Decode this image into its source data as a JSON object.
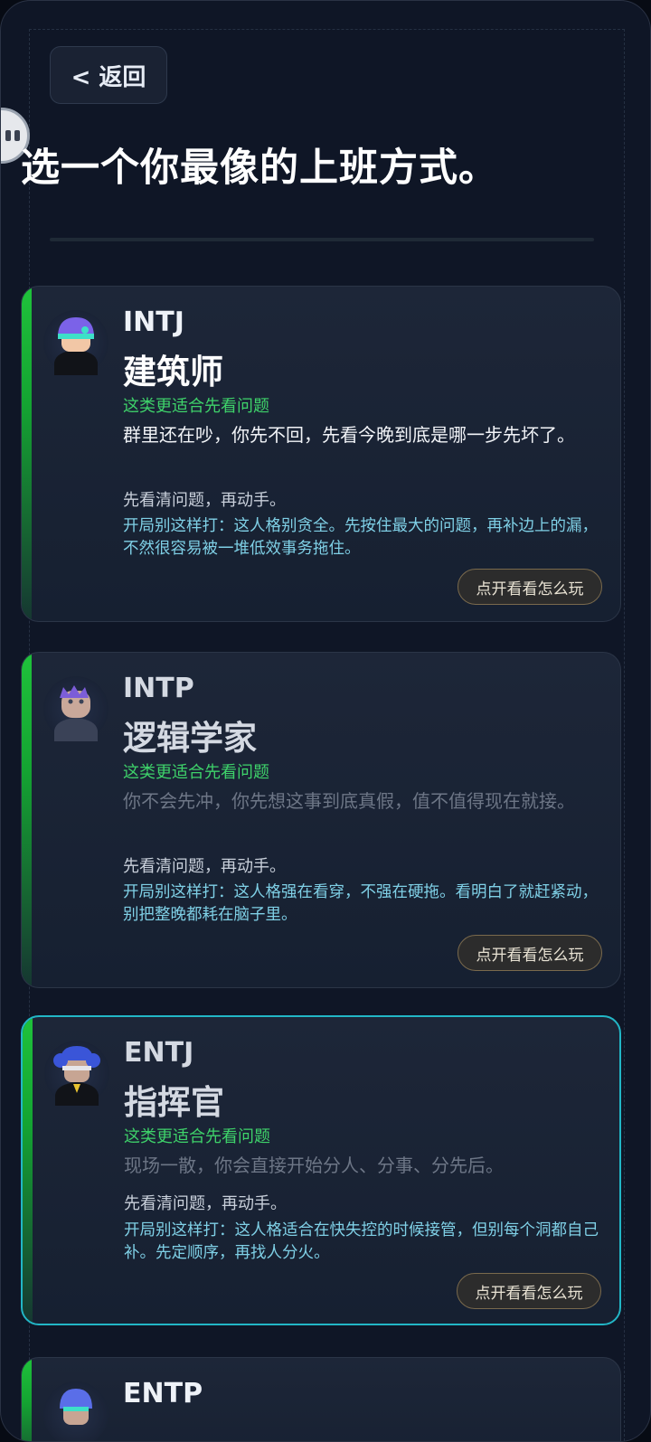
{
  "header": {
    "back_label": "< 返回",
    "title": "选一个你最像的上班方式。"
  },
  "cards": [
    {
      "code": "INTJ",
      "name": "建筑师",
      "fit": "这类更适合先看问题",
      "quote": "群里还在吵，你先不回，先看今晚到底是哪一步先坏了。",
      "tag": "先看清问题，再动手。",
      "tip": "开局别这样打：这人格别贪全。先按住最大的问题，再补边上的漏，不然很容易被一堆低效事务拖住。",
      "cta": "点开看看怎么玩"
    },
    {
      "code": "INTP",
      "name": "逻辑学家",
      "fit": "这类更适合先看问题",
      "quote": "你不会先冲，你先想这事到底真假，值不值得现在就接。",
      "tag": "先看清问题，再动手。",
      "tip": "开局别这样打：这人格强在看穿，不强在硬拖。看明白了就赶紧动，别把整晚都耗在脑子里。",
      "cta": "点开看看怎么玩"
    },
    {
      "code": "ENTJ",
      "name": "指挥官",
      "fit": "这类更适合先看问题",
      "quote": "现场一散，你会直接开始分人、分事、分先后。",
      "tag": "先看清问题，再动手。",
      "tip": "开局别这样打：这人格适合在快失控的时候接管，但别每个洞都自己补。先定顺序，再找人分火。",
      "cta": "点开看看怎么玩"
    },
    {
      "code": "ENTP"
    }
  ],
  "colors": {
    "accent_green": "#1fc23b",
    "fit_text": "#3ed26a",
    "tip_text": "#7fd0e6",
    "active_border": "#22b6c6"
  }
}
